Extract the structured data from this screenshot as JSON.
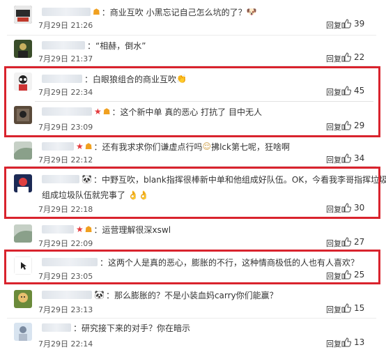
{
  "comments": [
    {
      "text": "：商业互吹 小黑忘记自己怎么坑的了？",
      "badges": [
        "vip"
      ],
      "emoji": "🐶",
      "time": "7月29日 21:26",
      "reply": "回复",
      "likes": "39",
      "avatar_colors": [
        "#2b2b2b",
        "#c0392b"
      ]
    },
    {
      "text": "：“相赫，倒水”",
      "badges": [],
      "time": "7月29日 21:37",
      "reply": "回复",
      "likes": "22",
      "avatar_colors": [
        "#3a4d2a",
        "#c8b060"
      ]
    },
    {
      "text": "：白眼狼组合的商业互吹",
      "badges": [],
      "emoji": "👏",
      "time": "7月29日 22:34",
      "reply": "回复",
      "likes": "45",
      "avatar_colors": [
        "#f2f2f2",
        "#222"
      ]
    },
    {
      "text": "：这个新中单 真的恶心 打抗了 目中无人",
      "badges": [
        "star",
        "vip"
      ],
      "time": "7月29日 23:09",
      "reply": "回复",
      "likes": "29",
      "avatar_colors": [
        "#5a4a3a",
        "#222"
      ]
    },
    {
      "text": "：还有我求求你们谦虚点行吗",
      "text2": "拂lck第七呢，狂啥啊",
      "badges": [
        "star",
        "vip"
      ],
      "emoji": "😌",
      "time": "7月29日 22:12",
      "reply": "回复",
      "likes": "34",
      "avatar_colors": [
        "#8aa08a",
        "#c6d0c6"
      ]
    },
    {
      "text": "：中野互吹，blank指挥很棒新中单和他组成好队伍。OK，今看我李哥指挥垃圾和他",
      "text_line2": "组成垃圾队伍就完事了",
      "badges": [
        "panda"
      ],
      "emoji": "👌👌",
      "time": "7月29日 22:18",
      "reply": "回复",
      "likes": "30",
      "avatar_colors": [
        "#1c2a55",
        "#e04040"
      ]
    },
    {
      "text": "：运营理解很深xswl",
      "badges": [
        "star",
        "vip"
      ],
      "time": "7月29日 22:09",
      "reply": "回复",
      "likes": "27",
      "avatar_colors": [
        "#8aa08a",
        "#c6d0c6"
      ]
    },
    {
      "text": "：这两个人是真的恶心，膨胀的不行，这种情商极低的人也有人喜欢？",
      "badges": [],
      "time": "7月29日 23:05",
      "reply": "回复",
      "likes": "25",
      "avatar_colors": [
        "#ffffff",
        "#222"
      ]
    },
    {
      "text": "：那么膨胀的？不是小装血妈carry你们能赢？",
      "badges": [
        "panda"
      ],
      "time": "7月29日 23:13",
      "reply": "回复",
      "likes": "15",
      "avatar_colors": [
        "#e8c070",
        "#6a8a3a"
      ]
    },
    {
      "text": "：研究接下来的对手？你在暗示",
      "badges": [],
      "time": "7月29日 22:14",
      "reply": "回复",
      "likes": "13",
      "avatar_colors": [
        "#d8e4f0",
        "#7a8aa0"
      ]
    }
  ]
}
